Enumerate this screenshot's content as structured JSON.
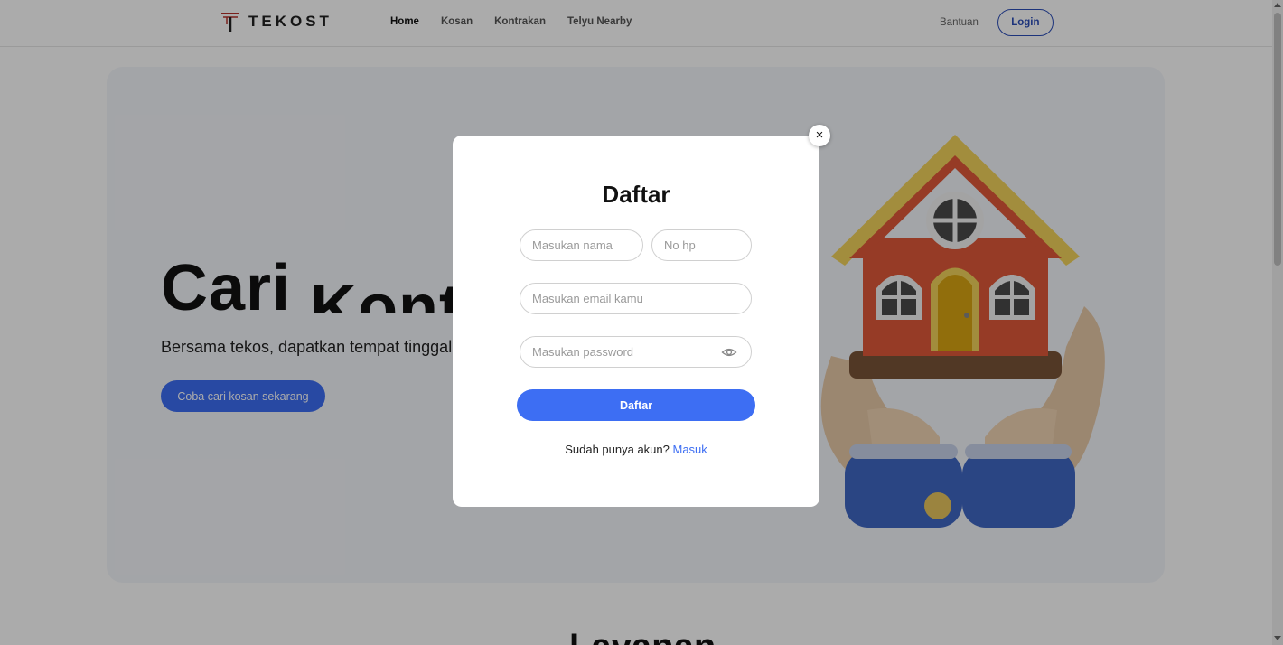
{
  "brand": {
    "name": "TEKOST",
    "accent": "#b5302a"
  },
  "nav": {
    "items": [
      {
        "label": "Home"
      },
      {
        "label": "Kosan"
      },
      {
        "label": "Kontrakan"
      },
      {
        "label": "Telyu Nearby"
      }
    ],
    "help_label": "Bantuan",
    "login_label": "Login"
  },
  "hero": {
    "title_static": "Cari",
    "title_rotating": "Kontrakan",
    "subtitle": "Bersama tekos, dapatkan tempat tinggal",
    "cta_label": "Coba cari kosan sekarang",
    "illustration": "house-in-hands-illustration"
  },
  "next_section": {
    "title": "Layanan"
  },
  "modal": {
    "close_label": "×",
    "title": "Daftar",
    "name_placeholder": "Masukan nama",
    "phone_placeholder": "No hp",
    "email_placeholder": "Masukan email kamu",
    "password_placeholder": "Masukan password",
    "password_toggle_icon": "eye-icon",
    "submit_label": "Daftar",
    "footer_text": "Sudah punya akun?",
    "footer_link": "Masuk"
  },
  "colors": {
    "primary": "#3d6ef3",
    "login_border": "#2b4db8",
    "hero_bg": "#f4f6fb",
    "overlay": "rgba(0,0,0,0.33)"
  }
}
